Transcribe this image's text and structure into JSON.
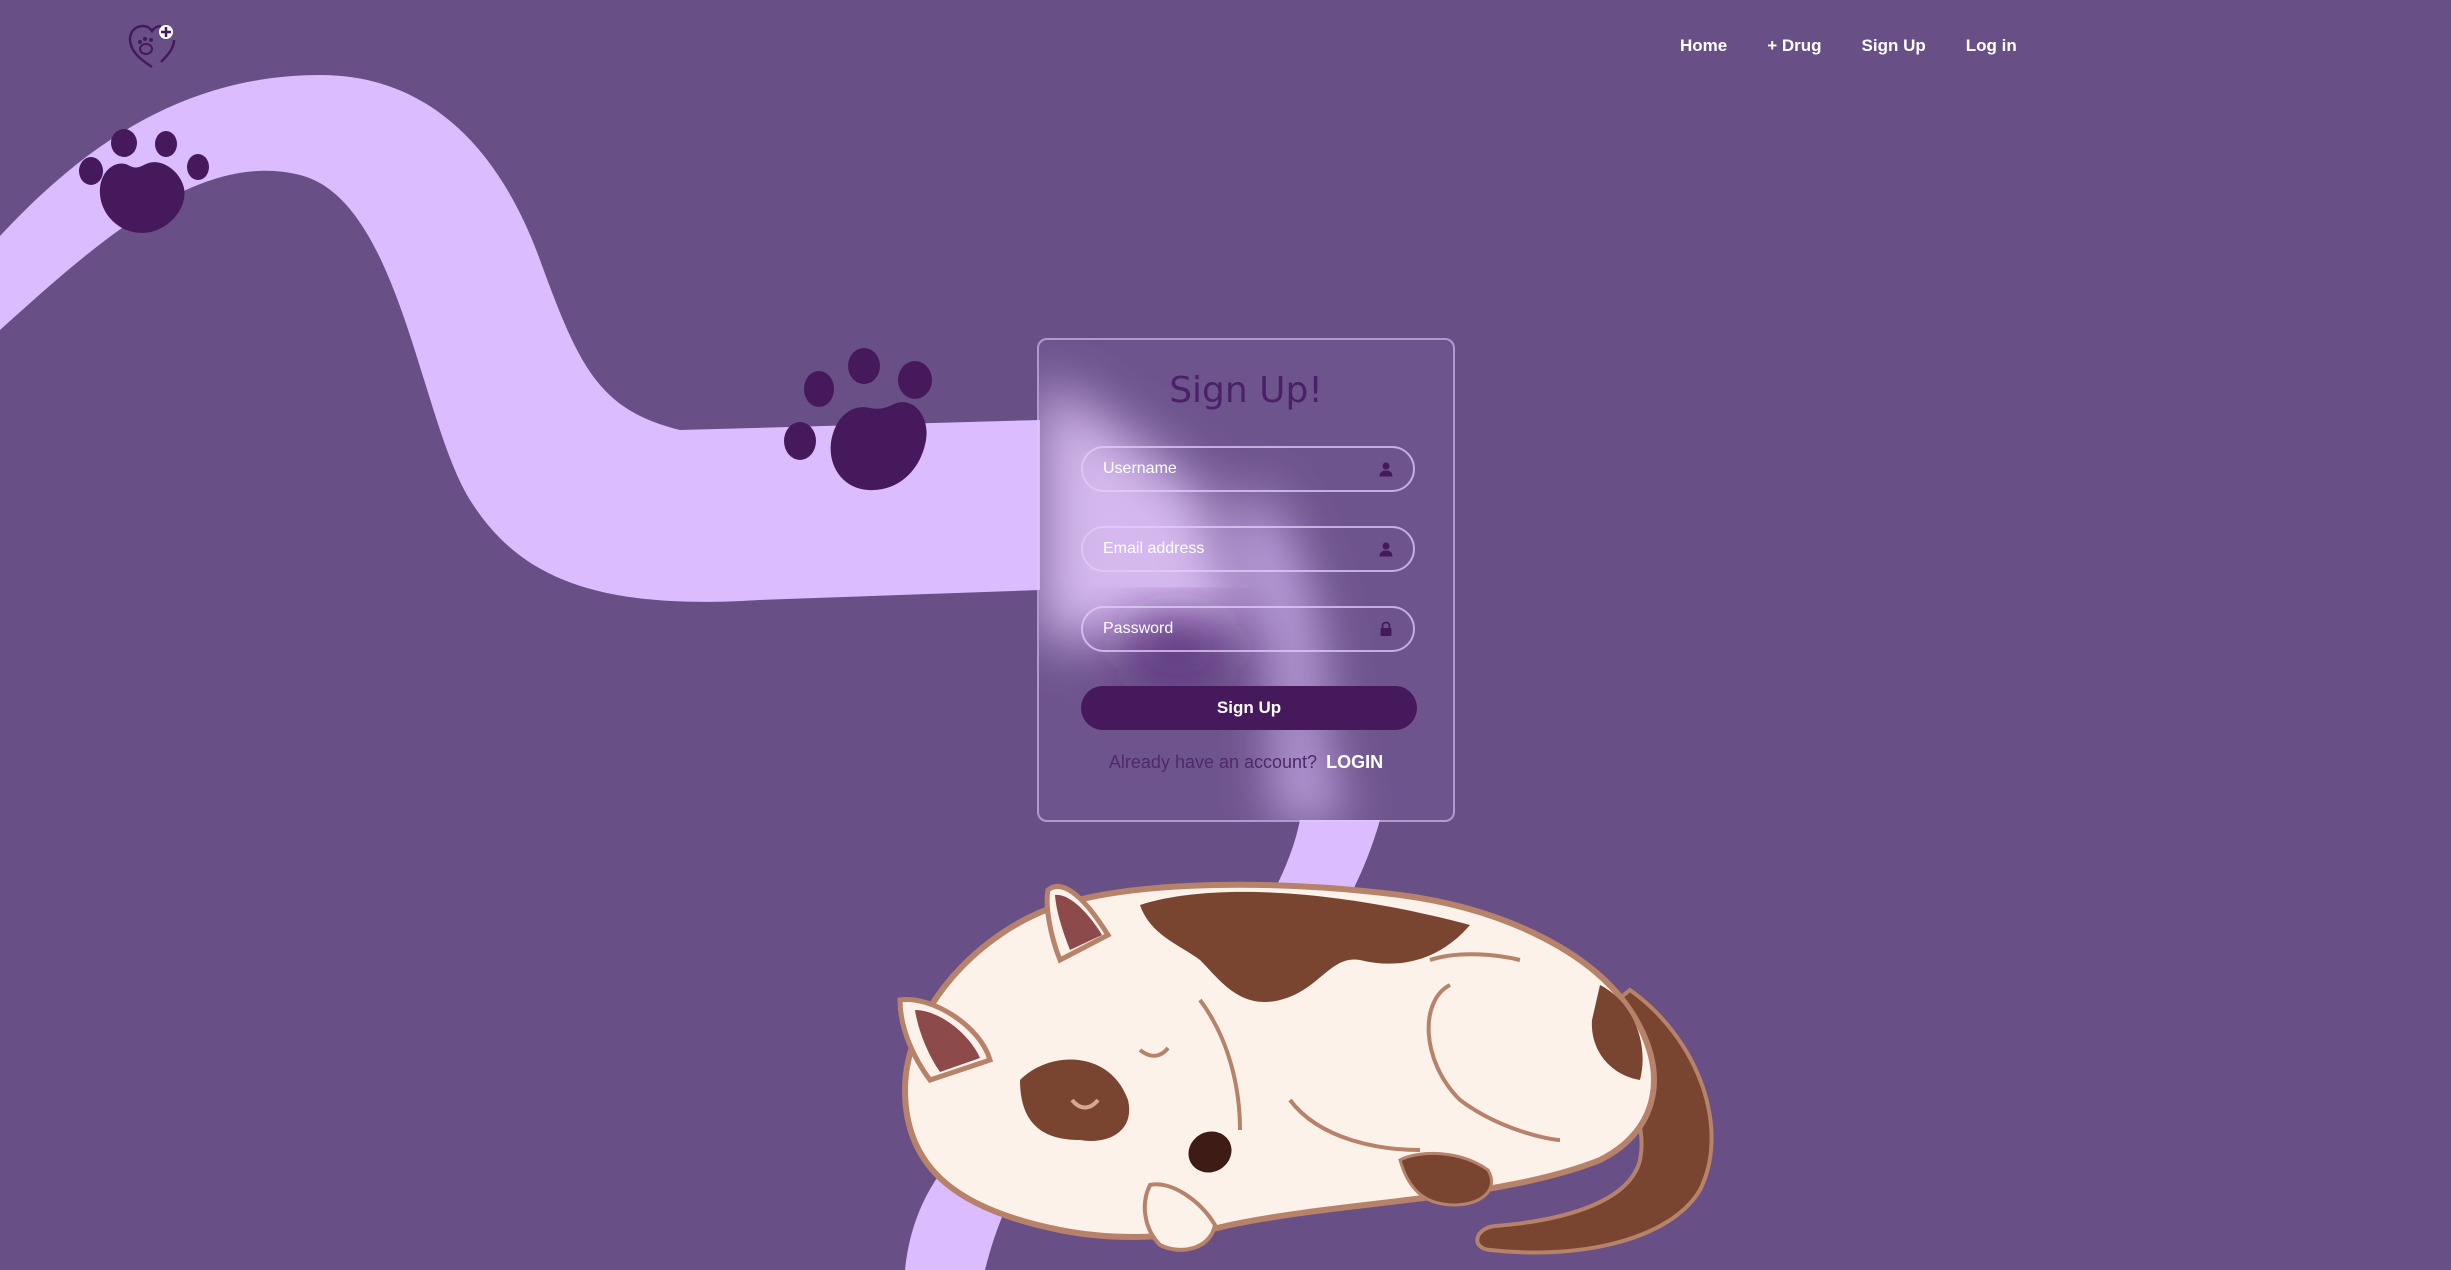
{
  "nav": {
    "logo_icon": "heart-paw-plus-icon",
    "items": [
      "Home",
      "+ Drug",
      "Sign Up",
      "Log in"
    ]
  },
  "form": {
    "title": "Sign Up!",
    "username_placeholder": "Username",
    "email_placeholder": "Email address",
    "password_placeholder": "Password",
    "username_icon": "user-icon",
    "email_icon": "user-icon",
    "password_icon": "lock-icon",
    "submit_label": "Sign Up",
    "login_prompt": "Already have an account?",
    "login_link": "LOGIN"
  },
  "colors": {
    "background": "#684f86",
    "path": "#dbbcff",
    "paw": "#45195c",
    "button": "#45195c",
    "title": "#4a2168"
  }
}
